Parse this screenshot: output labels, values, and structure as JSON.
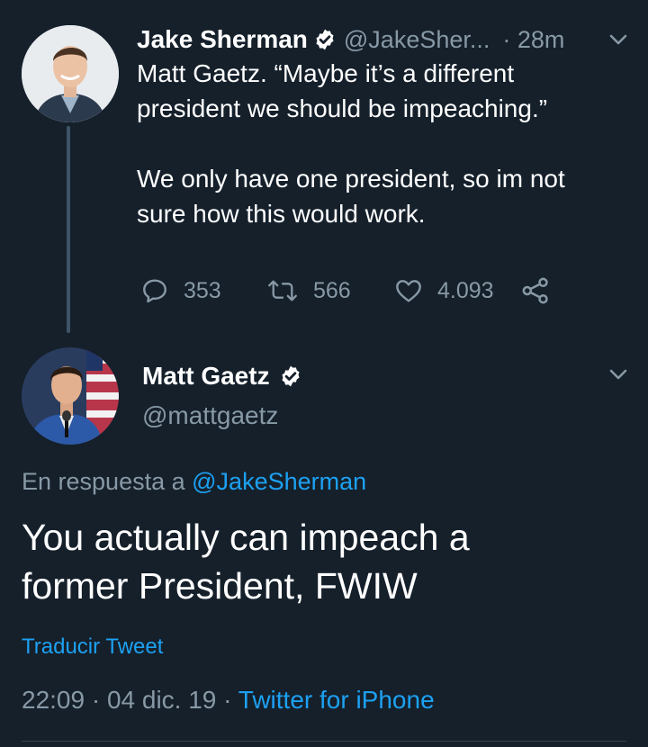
{
  "tweet1": {
    "author_name": "Jake Sherman",
    "handle": "@JakeSher...",
    "time": "· 28m",
    "text_line1": "Matt Gaetz. “Maybe it’s a different",
    "text_line2": "president we should be impeaching.”",
    "text_line3": "We only have one president, so im not",
    "text_line4": "sure how this would work.",
    "replies": "353",
    "retweets": "566",
    "likes": "4.093"
  },
  "tweet2": {
    "author_name": "Matt Gaetz",
    "handle": "@mattgaetz",
    "reply_prefix": "En respuesta a",
    "reply_to": "@JakeSherman",
    "text_line1": "You actually can impeach a",
    "text_line2": "former President, FWIW",
    "translate": "Traducir Tweet",
    "timestamp": "22:09 · 04 dic. 19 ·",
    "source": "Twitter for iPhone"
  },
  "colors": {
    "background": "#15202b",
    "muted": "#8899a6",
    "link": "#1da1f2"
  }
}
